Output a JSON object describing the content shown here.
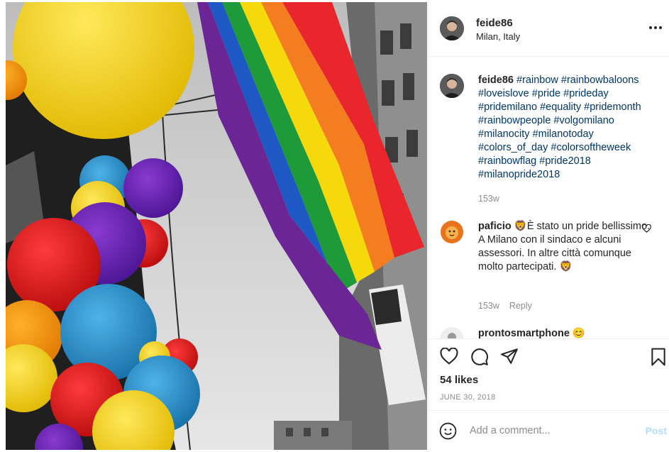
{
  "post": {
    "username": "feide86",
    "location": "Milan, Italy",
    "more_icon": "more-horizontal-icon"
  },
  "caption": {
    "username": "feide86",
    "hashtags": [
      "#rainbow",
      "#rainbowbaloons",
      "#loveislove",
      "#pride",
      "#prideday",
      "#pridemilano",
      "#equality",
      "#pridemonth",
      "#rainbowpeople",
      "#volgomilano",
      "#milanocity",
      "#milanotoday",
      "#colors_of_day",
      "#colorsoftheweek",
      "#rainbowflag",
      "#pride2018",
      "#milanopride2018"
    ],
    "time": "153w"
  },
  "comments": [
    {
      "username": "paficio",
      "text": "🦁È stato un pride bellissimo. A Milano con il sindaco e alcuni assessori. In altre città comunque molto partecipati. 🦁",
      "time": "153w",
      "reply_label": "Reply"
    },
    {
      "username": "prontosmartphone",
      "text": "😊"
    }
  ],
  "actions": {
    "icons": [
      "heart-icon",
      "comment-icon",
      "share-icon",
      "bookmark-icon"
    ],
    "likes": "54 likes",
    "date": "JUNE 30, 2018"
  },
  "add_comment": {
    "placeholder": "Add a comment...",
    "post_label": "Post",
    "post_color": "#b2dffc"
  },
  "colors": {
    "hashtag": "#00376b",
    "muted": "#8e8e8e"
  }
}
